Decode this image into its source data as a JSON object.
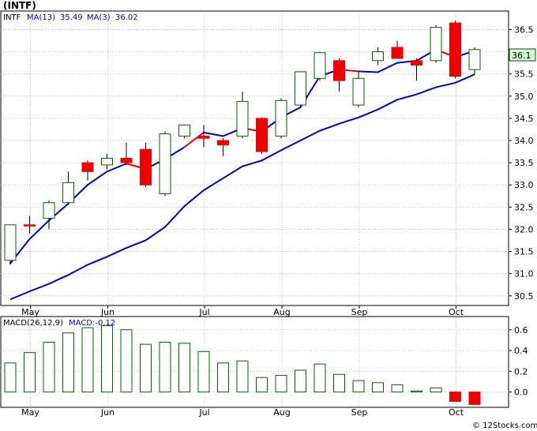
{
  "title": "(INTF)",
  "price_panel": {
    "symbol": "INTF",
    "ma13_label": "MA(13)",
    "ma13_value": "35.49",
    "ma3_label": "MA(3)",
    "ma3_value": "36.02",
    "last_price": "36.1"
  },
  "macd_panel": {
    "label": "MACD(26,12,9)",
    "value_label": "MACD:-0.12"
  },
  "copyright": "© 12Stocks.com",
  "colors": {
    "up_fill": "#ffffff",
    "up_stroke": "#006600",
    "down_fill": "#ee0000",
    "ma13": "#0000cc",
    "ma3_up": "#0000cc",
    "ma3_down": "#ee0000",
    "macd_stroke": "#006600",
    "macd_neg_fill": "#ee0000",
    "grid": "#c8c8c8",
    "price_tag_bg": "#ccffcc"
  },
  "chart_data": {
    "type": "candlestick",
    "x_labels": [
      "May",
      "Jun",
      "Jul",
      "Aug",
      "Sep",
      "Oct"
    ],
    "x_label_index": [
      1,
      5,
      10,
      14,
      18,
      23
    ],
    "price_ylim": [
      30.3,
      36.9
    ],
    "price_yticks": [
      "30.5",
      "31.0",
      "31.5",
      "32.0",
      "32.5",
      "33.0",
      "33.5",
      "34.0",
      "34.5",
      "35.0",
      "35.5",
      "36.0",
      "36.5"
    ],
    "candles": [
      {
        "o": 31.3,
        "h": 32.1,
        "l": 31.2,
        "c": 32.1
      },
      {
        "o": 32.1,
        "h": 32.3,
        "l": 31.9,
        "c": 32.08
      },
      {
        "o": 32.25,
        "h": 32.65,
        "l": 32.0,
        "c": 32.6
      },
      {
        "o": 32.6,
        "h": 33.3,
        "l": 32.55,
        "c": 33.05
      },
      {
        "o": 33.5,
        "h": 33.55,
        "l": 33.1,
        "c": 33.3
      },
      {
        "o": 33.45,
        "h": 33.7,
        "l": 33.35,
        "c": 33.6
      },
      {
        "o": 33.6,
        "h": 33.95,
        "l": 33.45,
        "c": 33.5
      },
      {
        "o": 33.8,
        "h": 33.95,
        "l": 32.95,
        "c": 33.0
      },
      {
        "o": 32.8,
        "h": 34.2,
        "l": 32.75,
        "c": 34.15
      },
      {
        "o": 34.1,
        "h": 34.35,
        "l": 34.05,
        "c": 34.35
      },
      {
        "o": 34.1,
        "h": 34.35,
        "l": 33.85,
        "c": 34.05
      },
      {
        "o": 34.0,
        "h": 34.05,
        "l": 33.65,
        "c": 33.9
      },
      {
        "o": 34.1,
        "h": 35.1,
        "l": 34.05,
        "c": 34.88
      },
      {
        "o": 34.5,
        "h": 34.52,
        "l": 33.7,
        "c": 33.75
      },
      {
        "o": 34.1,
        "h": 34.95,
        "l": 34.05,
        "c": 34.9
      },
      {
        "o": 34.8,
        "h": 35.55,
        "l": 34.75,
        "c": 35.55
      },
      {
        "o": 35.4,
        "h": 36.0,
        "l": 35.35,
        "c": 35.98
      },
      {
        "o": 35.8,
        "h": 35.85,
        "l": 35.1,
        "c": 35.35
      },
      {
        "o": 34.8,
        "h": 35.55,
        "l": 34.75,
        "c": 35.4
      },
      {
        "o": 35.8,
        "h": 36.1,
        "l": 35.7,
        "c": 36.0
      },
      {
        "o": 36.1,
        "h": 36.25,
        "l": 35.85,
        "c": 35.85
      },
      {
        "o": 35.8,
        "h": 35.85,
        "l": 35.35,
        "c": 35.7
      },
      {
        "o": 35.8,
        "h": 36.6,
        "l": 35.75,
        "c": 36.55
      },
      {
        "o": 36.65,
        "h": 36.7,
        "l": 35.4,
        "c": 35.45
      },
      {
        "o": 35.6,
        "h": 36.1,
        "l": 35.5,
        "c": 36.05
      }
    ],
    "ma13": [
      30.42,
      30.6,
      30.77,
      30.97,
      31.2,
      31.38,
      31.58,
      31.75,
      32.05,
      32.52,
      32.88,
      33.15,
      33.42,
      33.55,
      33.78,
      34.0,
      34.22,
      34.38,
      34.52,
      34.7,
      34.92,
      35.04,
      35.2,
      35.3,
      35.49
    ],
    "ma3": [
      31.23,
      31.78,
      32.2,
      32.58,
      33.0,
      33.3,
      33.48,
      33.36,
      33.58,
      33.85,
      34.18,
      34.1,
      34.28,
      34.2,
      34.52,
      34.75,
      35.45,
      35.6,
      35.56,
      35.54,
      35.75,
      35.8,
      36.05,
      35.88,
      36.02
    ],
    "ma3_down_segments": [
      6,
      9,
      12,
      17,
      22
    ],
    "macd_ylim": [
      -0.14,
      0.72
    ],
    "macd_yticks": [
      "0.0",
      "0.2",
      "0.4",
      "0.6"
    ],
    "macd": [
      0.28,
      0.38,
      0.48,
      0.57,
      0.62,
      0.64,
      0.6,
      0.46,
      0.48,
      0.47,
      0.39,
      0.28,
      0.3,
      0.14,
      0.16,
      0.21,
      0.27,
      0.17,
      0.11,
      0.09,
      0.07,
      0.01,
      0.04,
      -0.09,
      -0.12
    ]
  }
}
